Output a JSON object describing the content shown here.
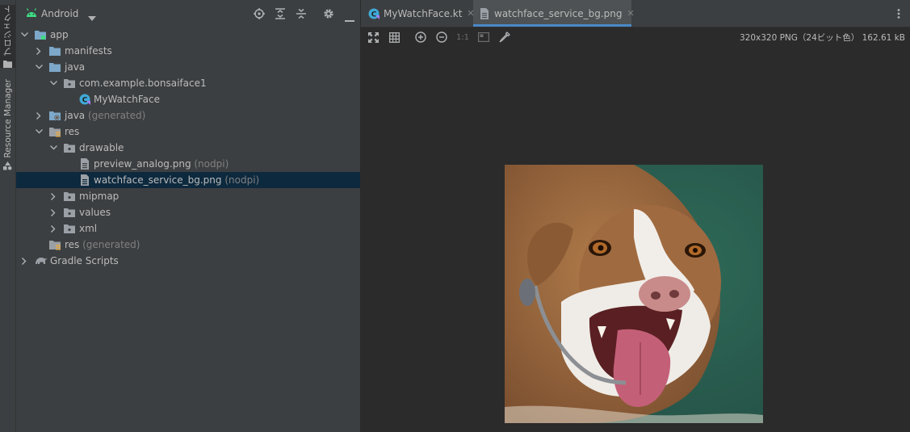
{
  "side_stripe": {
    "project_tab": "プロジェクト",
    "resource_tab": "Resource Manager"
  },
  "project_panel": {
    "view_selector": "Android",
    "tree": [
      {
        "label": "app",
        "sub": "",
        "icon": "app-module-icon",
        "expanded": true
      },
      {
        "label": "manifests",
        "sub": "",
        "icon": "folder-icon",
        "expanded": false
      },
      {
        "label": "java",
        "sub": "",
        "icon": "folder-icon",
        "expanded": true
      },
      {
        "label": "com.example.bonsaiface1",
        "sub": "",
        "icon": "package-icon",
        "expanded": true
      },
      {
        "label": "MyWatchFace",
        "sub": "",
        "icon": "kotlin-class-icon"
      },
      {
        "label": "java",
        "sub": " (generated)",
        "icon": "generated-folder-icon",
        "expanded": false
      },
      {
        "label": "res",
        "sub": "",
        "icon": "res-folder-icon",
        "expanded": true
      },
      {
        "label": "drawable",
        "sub": "",
        "icon": "package-icon",
        "expanded": true
      },
      {
        "label": "preview_analog.png",
        "sub": " (nodpi)",
        "icon": "image-file-icon"
      },
      {
        "label": "watchface_service_bg.png",
        "sub": " (nodpi)",
        "icon": "image-file-icon",
        "selected": true
      },
      {
        "label": "mipmap",
        "sub": "",
        "icon": "package-icon",
        "expanded": false
      },
      {
        "label": "values",
        "sub": "",
        "icon": "package-icon",
        "expanded": false
      },
      {
        "label": "xml",
        "sub": "",
        "icon": "package-icon",
        "expanded": false
      },
      {
        "label": "res",
        "sub": " (generated)",
        "icon": "res-folder-icon"
      },
      {
        "label": "Gradle Scripts",
        "sub": "",
        "icon": "gradle-icon",
        "expanded": false
      }
    ]
  },
  "editor": {
    "tabs": [
      {
        "label": "MyWatchFace.kt",
        "icon": "kotlin-class-icon",
        "active": false
      },
      {
        "label": "watchface_service_bg.png",
        "icon": "image-file-icon",
        "active": true
      }
    ],
    "image_toolbar": {
      "actual_size_label": "1:1",
      "info": "320x320 PNG（24ビット色） 162.61 kB"
    },
    "image_subject": "dog-photo",
    "colors": {
      "accent": "#4a88c7",
      "selection": "#0d293e",
      "folder": "#7da8c9"
    }
  }
}
